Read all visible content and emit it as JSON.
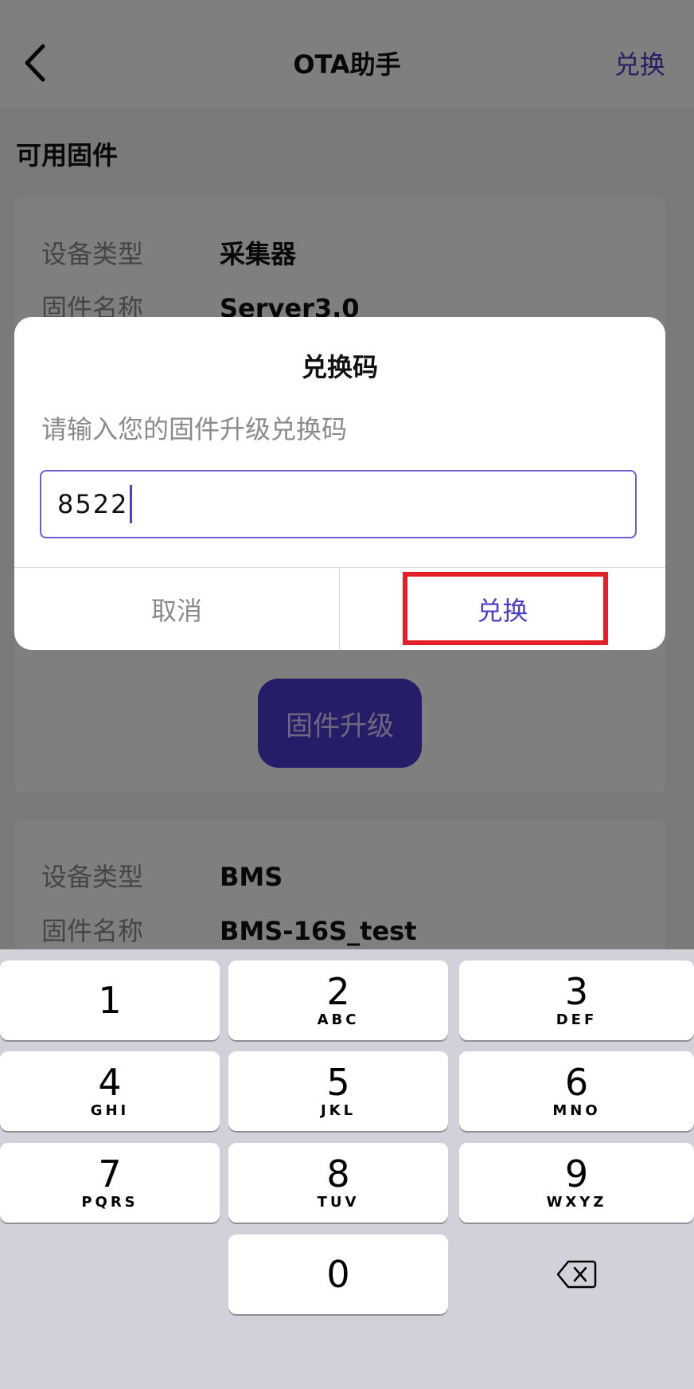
{
  "nav": {
    "title": "OTA助手",
    "action_label": "兑换"
  },
  "section_title": "可用固件",
  "cards": [
    {
      "device_type_label": "设备类型",
      "device_type_value": "采集器",
      "firmware_name_label": "固件名称",
      "firmware_name_value": "Server3.0",
      "upgrade_button": "固件升级"
    },
    {
      "device_type_label": "设备类型",
      "device_type_value": "BMS",
      "firmware_name_label": "固件名称",
      "firmware_name_value": "BMS-16S_test"
    }
  ],
  "dialog": {
    "title": "兑换码",
    "message": "请输入您的固件升级兑换码",
    "input_value": "8522",
    "cancel_label": "取消",
    "confirm_label": "兑换"
  },
  "keyboard": {
    "keys": [
      {
        "num": "1",
        "letters": ""
      },
      {
        "num": "2",
        "letters": "ABC"
      },
      {
        "num": "3",
        "letters": "DEF"
      },
      {
        "num": "4",
        "letters": "GHI"
      },
      {
        "num": "5",
        "letters": "JKL"
      },
      {
        "num": "6",
        "letters": "MNO"
      },
      {
        "num": "7",
        "letters": "PQRS"
      },
      {
        "num": "8",
        "letters": "TUV"
      },
      {
        "num": "9",
        "letters": "WXYZ"
      },
      {
        "num": "0",
        "letters": ""
      }
    ],
    "delete_icon": "backspace-icon"
  },
  "colors": {
    "accent": "#4c3ec9",
    "highlight": "#e3202a",
    "keyboard_bg": "#d1d2d9"
  }
}
